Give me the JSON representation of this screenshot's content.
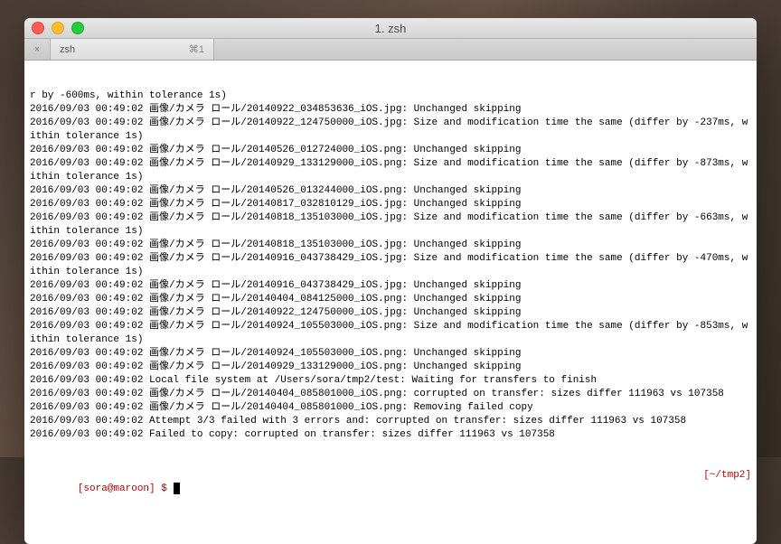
{
  "window": {
    "title": "1. zsh"
  },
  "tab": {
    "label": "zsh",
    "shortcut": "⌘1",
    "close_glyph": "×"
  },
  "lines": [
    "r by -600ms, within tolerance 1s)",
    "2016/09/03 00:49:02 画像/カメラ ロール/20140922_034853636_iOS.jpg: Unchanged skipping",
    "2016/09/03 00:49:02 画像/カメラ ロール/20140922_124750000_iOS.jpg: Size and modification time the same (differ by -237ms, within tolerance 1s)",
    "2016/09/03 00:49:02 画像/カメラ ロール/20140526_012724000_iOS.png: Unchanged skipping",
    "2016/09/03 00:49:02 画像/カメラ ロール/20140929_133129000_iOS.png: Size and modification time the same (differ by -873ms, within tolerance 1s)",
    "2016/09/03 00:49:02 画像/カメラ ロール/20140526_013244000_iOS.png: Unchanged skipping",
    "2016/09/03 00:49:02 画像/カメラ ロール/20140817_032810129_iOS.jpg: Unchanged skipping",
    "2016/09/03 00:49:02 画像/カメラ ロール/20140818_135103000_iOS.jpg: Size and modification time the same (differ by -663ms, within tolerance 1s)",
    "2016/09/03 00:49:02 画像/カメラ ロール/20140818_135103000_iOS.jpg: Unchanged skipping",
    "2016/09/03 00:49:02 画像/カメラ ロール/20140916_043738429_iOS.jpg: Size and modification time the same (differ by -470ms, within tolerance 1s)",
    "2016/09/03 00:49:02 画像/カメラ ロール/20140916_043738429_iOS.jpg: Unchanged skipping",
    "2016/09/03 00:49:02 画像/カメラ ロール/20140404_084125000_iOS.png: Unchanged skipping",
    "2016/09/03 00:49:02 画像/カメラ ロール/20140922_124750000_iOS.jpg: Unchanged skipping",
    "2016/09/03 00:49:02 画像/カメラ ロール/20140924_105503000_iOS.png: Size and modification time the same (differ by -853ms, within tolerance 1s)",
    "2016/09/03 00:49:02 画像/カメラ ロール/20140924_105503000_iOS.png: Unchanged skipping",
    "2016/09/03 00:49:02 画像/カメラ ロール/20140929_133129000_iOS.png: Unchanged skipping",
    "2016/09/03 00:49:02 Local file system at /Users/sora/tmp2/test: Waiting for transfers to finish",
    "2016/09/03 00:49:02 画像/カメラ ロール/20140404_085801000_iOS.png: corrupted on transfer: sizes differ 111963 vs 107358",
    "2016/09/03 00:49:02 画像/カメラ ロール/20140404_085801000_iOS.png: Removing failed copy",
    "2016/09/03 00:49:02 Attempt 3/3 failed with 3 errors and: corrupted on transfer: sizes differ 111963 vs 107358",
    "2016/09/03 00:49:02 Failed to copy: corrupted on transfer: sizes differ 111963 vs 107358"
  ],
  "prompt": {
    "left": "[sora@maroon] $ ",
    "right": "[~/tmp2]"
  }
}
